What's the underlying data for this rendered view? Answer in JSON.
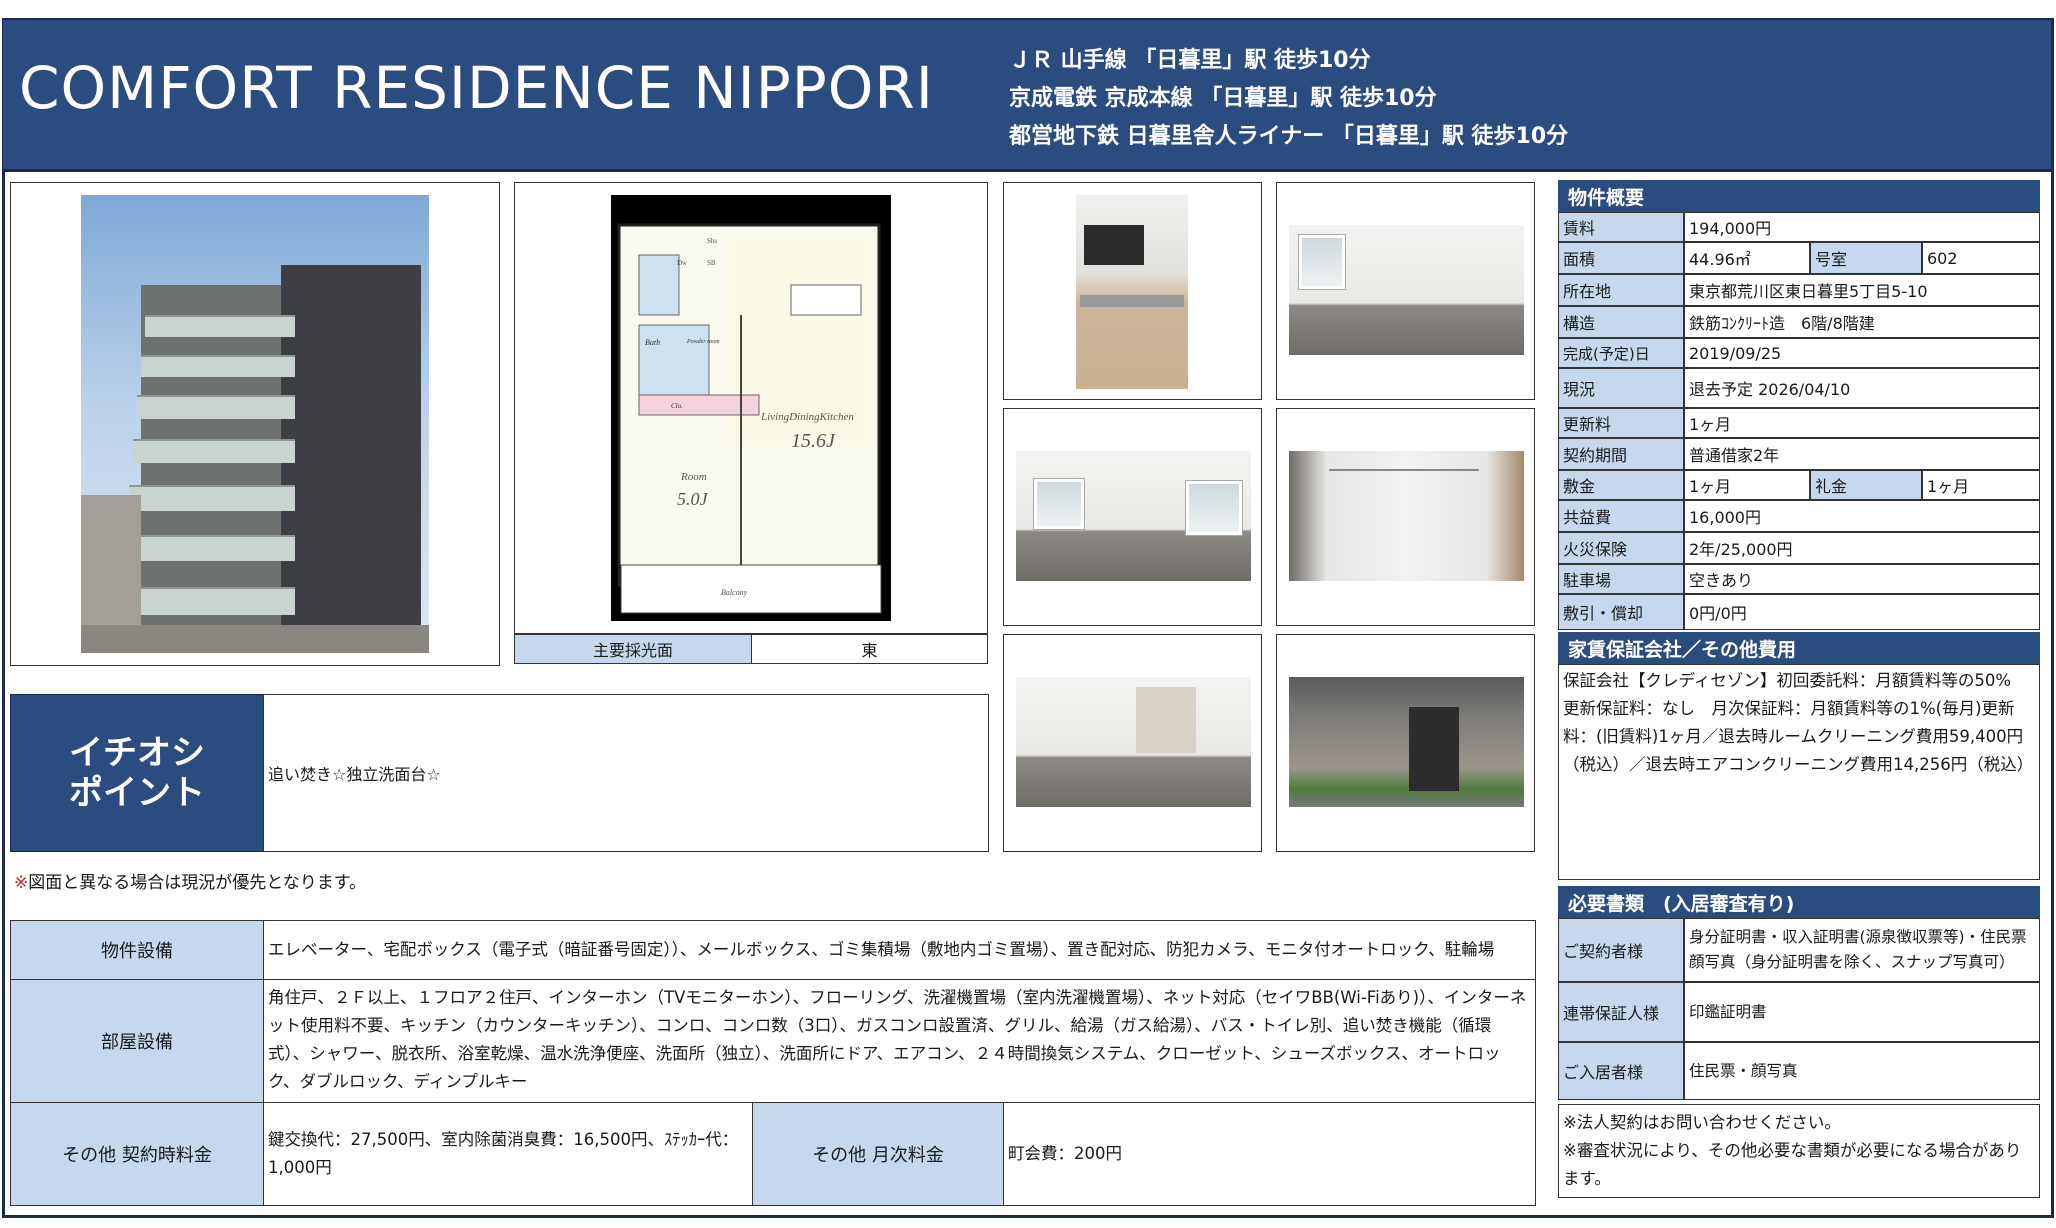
{
  "header": {
    "title": "COMFORT RESIDENCE NIPPORI",
    "access": [
      "ＪＲ 山手線 「日暮里」駅 徒歩10分",
      "京成電鉄 京成本線 「日暮里」駅 徒歩10分",
      "都営地下鉄 日暮里舎人ライナー 「日暮里」駅 徒歩10分"
    ]
  },
  "floorplan": {
    "rooms": [
      "Bath",
      "Powder room",
      "Clo.",
      "Room",
      "5.0J",
      "LivingDiningKitchen",
      "15.6J",
      "Balcony",
      "Shs",
      "SB",
      "Dw"
    ],
    "light": {
      "label": "主要採光面",
      "value": "東"
    }
  },
  "pick": {
    "label_line1": "イチオシ",
    "label_line2": "ポイント",
    "value": "追い焚き☆独立洗面台☆"
  },
  "note": {
    "mark": "※",
    "text": "図面と異なる場合は現況が優先となります。"
  },
  "equipment": {
    "building_label": "物件設備",
    "building_value": "エレベーター、宅配ボックス（電子式（暗証番号固定））、メールボックス、ゴミ集積場（敷地内ゴミ置場）、置き配対応、防犯カメラ、モニタ付オートロック、駐輪場",
    "room_label": "部屋設備",
    "room_value": "角住戸、２Ｆ以上、１フロア２住戸、インターホン（TVモニターホン）、フローリング、洗濯機置場（室内洗濯機置場）、ネット対応（セイワBB(Wi-Fiあり)）、インターネット使用料不要、キッチン（カウンターキッチン）、コンロ、コンロ数（3口）、ガスコンロ設置済、グリル、給湯（ガス給湯）、バス・トイレ別、追い焚き機能（循環式）、シャワー、脱衣所、浴室乾燥、温水洗浄便座、洗面所（独立）、洗面所にドア、エアコン、２４時間換気システム、クローゼット、シューズボックス、オートロック、ダブルロック、ディンプルキー",
    "contract_fee_label": "その他 契約時料金",
    "contract_fee_value": "鍵交換代：27,500円、室内除菌消臭費：16,500円、ｽﾃｯｶｰ代：1,000円",
    "monthly_fee_label": "その他 月次料金",
    "monthly_fee_value": "町会費：200円"
  },
  "overview": {
    "heading": "物件概要",
    "rent_label": "賃料",
    "rent": "194,000円",
    "area_label": "面積",
    "area": "44.96㎡",
    "room_no_label": "号室",
    "room_no": "602",
    "address_label": "所在地",
    "address": "東京都荒川区東日暮里5丁目5-10",
    "structure_label": "構造",
    "structure": "鉄筋ｺﾝｸﾘｰﾄ造　6階/8階建",
    "completed_label": "完成(予定)日",
    "completed": "2019/09/25",
    "status_label": "現況",
    "status": "退去予定 2026/04/10",
    "renewal_label": "更新料",
    "renewal": "1ヶ月",
    "term_label": "契約期間",
    "term": "普通借家2年",
    "deposit_label": "敷金",
    "deposit": "1ヶ月",
    "key_money_label": "礼金",
    "key_money": "1ヶ月",
    "common_fee_label": "共益費",
    "common_fee": "16,000円",
    "insurance_label": "火災保険",
    "insurance": "2年/25,000円",
    "parking_label": "駐車場",
    "parking": "空きあり",
    "deduction_label": "敷引・償却",
    "deduction": "0円/0円"
  },
  "guarantee": {
    "heading": "家賃保証会社／その他費用",
    "text": "保証会社【クレディセゾン】初回委託料：月額賃料等の50%　更新保証料：なし　月次保証料：月額賃料等の1%(毎月)更新料：(旧賃料)1ヶ月／退去時ルームクリーニング費用59,400円（税込）／退去時エアコンクリーニング費用14,256円（税込）"
  },
  "documents": {
    "heading": "必要書類　(入居審査有り)",
    "contractor_label": "ご契約者様",
    "contractor_value": "身分証明書・収入証明書(源泉徴収票等)・住民票　顔写真（身分証明書を除く、スナップ写真可）",
    "joint_label": "連帯保証人様",
    "joint_value": "印鑑証明書",
    "resident_label": "ご入居者様",
    "resident_value": "住民票・顔写真",
    "note1": "※法人契約はお問い合わせください。",
    "note2": "※審査状況により、その他必要な書類が必要になる場合があります。"
  },
  "colors": {
    "navy": "#2b4c7e",
    "label_bg": "#c7d8ee",
    "note_mark": "#d0232a"
  }
}
